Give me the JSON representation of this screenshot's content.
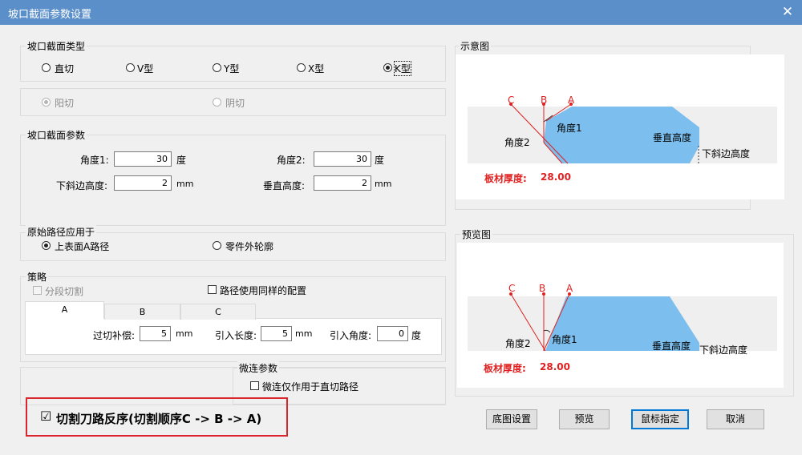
{
  "window": {
    "title": "坡口截面参数设置",
    "close_glyph": "✕"
  },
  "section_type": {
    "label": "坡口截面类型",
    "options": [
      "直切",
      "V型",
      "Y型",
      "X型",
      "K型"
    ],
    "selected": "K型",
    "sides": [
      "阳切",
      "阴切"
    ],
    "side_selected": "阳切"
  },
  "params": {
    "label": "坡口截面参数",
    "angle1_label": "角度1:",
    "angle1_value": "30",
    "angle1_unit": "度",
    "angle2_label": "角度2:",
    "angle2_value": "30",
    "angle2_unit": "度",
    "bevel_height_label": "下斜边高度:",
    "bevel_height_value": "2",
    "bevel_height_unit": "mm",
    "vertical_height_label": "垂直高度:",
    "vertical_height_value": "2",
    "vertical_height_unit": "mm"
  },
  "path_apply": {
    "label": "原始路径应用于",
    "options": [
      "上表面A路径",
      "零件外轮廓"
    ],
    "selected": "上表面A路径"
  },
  "strategy": {
    "label": "策略",
    "segment_cut": "分段切割",
    "same_config": "路径使用同样的配置",
    "tabs": [
      "A",
      "B",
      "C"
    ],
    "active_tab": "A",
    "overcut_label": "过切补偿:",
    "overcut_value": "5",
    "overcut_unit": "mm",
    "leadin_len_label": "引入长度:",
    "leadin_len_value": "5",
    "leadin_len_unit": "mm",
    "leadin_angle_label": "引入角度:",
    "leadin_angle_value": "0",
    "leadin_angle_unit": "度"
  },
  "micro": {
    "label": "微连参数",
    "only_straight": "微连仅作用于直切路径"
  },
  "reverse": {
    "label": "切割刀路反序(切割顺序C -> B -> A)",
    "checked": true,
    "check_glyph": "☑"
  },
  "schematic": {
    "label": "示意图",
    "letters": [
      "C",
      "B",
      "A"
    ],
    "angle1": "角度1",
    "angle2": "角度2",
    "vertical_height": "垂直高度",
    "bevel_height": "下斜边高度",
    "thickness_label": "板材厚度:",
    "thickness_value": "28.00"
  },
  "preview": {
    "label": "预览图",
    "letters": [
      "C",
      "B",
      "A"
    ],
    "angle1": "角度1",
    "angle2": "角度2",
    "vertical_height": "垂直高度",
    "bevel_height": "下斜边高度",
    "thickness_label": "板材厚度:",
    "thickness_value": "28.00"
  },
  "buttons": {
    "base": "底图设置",
    "preview": "预览",
    "mouse": "鼠标指定",
    "cancel": "取消"
  },
  "colors": {
    "accent": "#0078d7",
    "red": "#e02020",
    "blue_fill": "#7cbfee",
    "title_bar": "#5b8fc9"
  }
}
